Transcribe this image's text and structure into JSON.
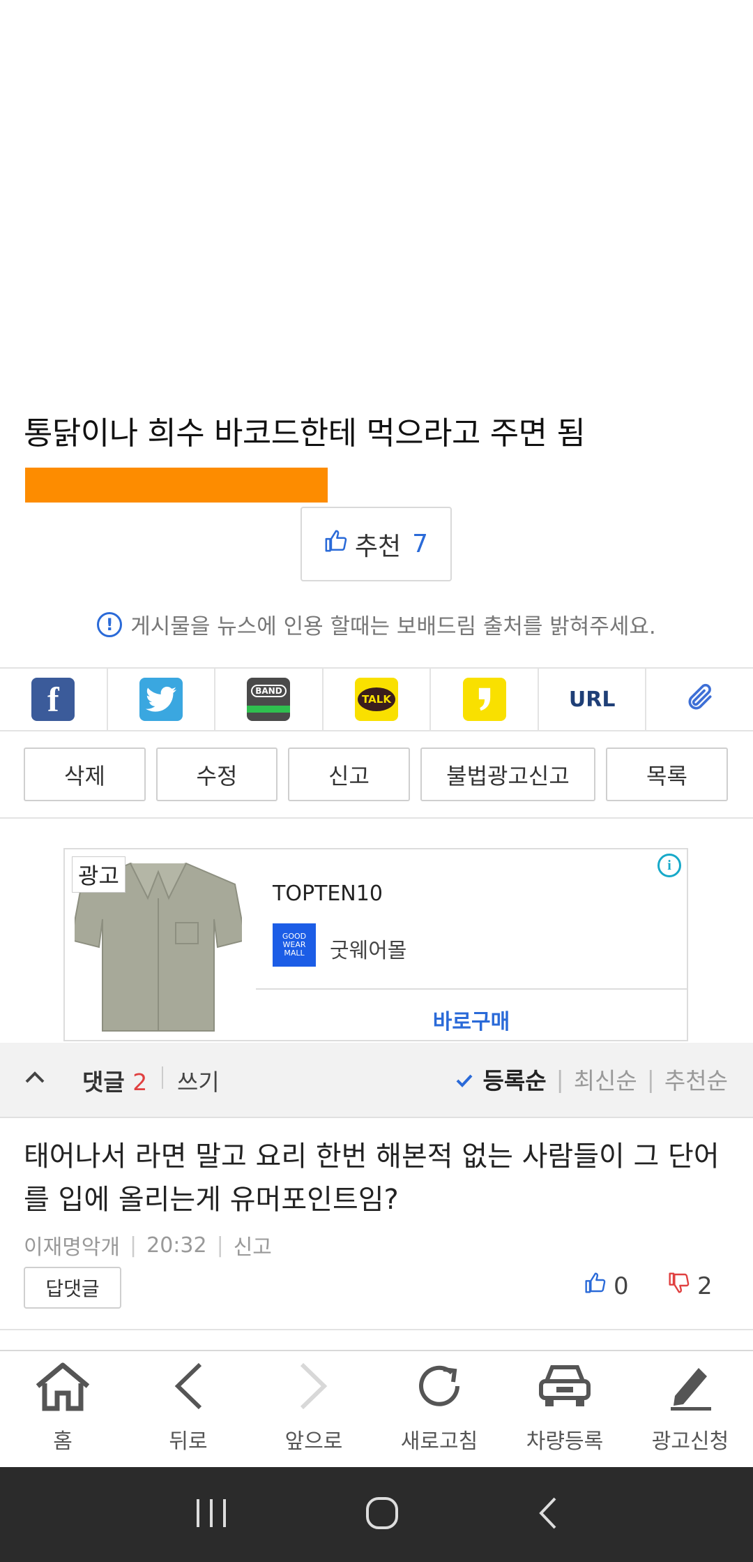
{
  "post": {
    "body_line": "통닭이나 희수 바코드한테 먹으라고 주면 됨",
    "recommend_label": "추천",
    "recommend_count": "7"
  },
  "notice": "게시물을 뉴스에 인용 할때는 보배드림 출처를 밝혀주세요.",
  "share": {
    "band": "BAND",
    "talk": "TALK",
    "url": "URL"
  },
  "actions": [
    "삭제",
    "수정",
    "신고",
    "불법광고신고",
    "목록"
  ],
  "ad": {
    "badge": "광고",
    "brand": "TOPTEN10",
    "logo_text": "GOOD WEAR MALL",
    "mall": "굿웨어몰",
    "cta": "바로구매"
  },
  "comments": {
    "label": "댓글",
    "count": "2",
    "write": "쓰기",
    "sort_active": "등록순",
    "sort_latest": "최신순",
    "sort_reco": "추천순",
    "items": [
      {
        "text": "태어나서 라면 말고 요리 한번 해본적 없는 사람들이 그 단어를 입에 올리는게 유머포인트임?",
        "author": "이재명악개",
        "time": "20:32",
        "report": "신고",
        "reply_label": "답댓글",
        "likes": "0",
        "dislikes": "2"
      }
    ]
  },
  "nav": {
    "home": "홈",
    "back": "뒤로",
    "forward": "앞으로",
    "refresh": "새로고침",
    "car": "차량등록",
    "ad_apply": "광고신청"
  },
  "colors": {
    "accent": "#2a6ad8",
    "orange": "#fd8c00",
    "red": "#e04040"
  }
}
